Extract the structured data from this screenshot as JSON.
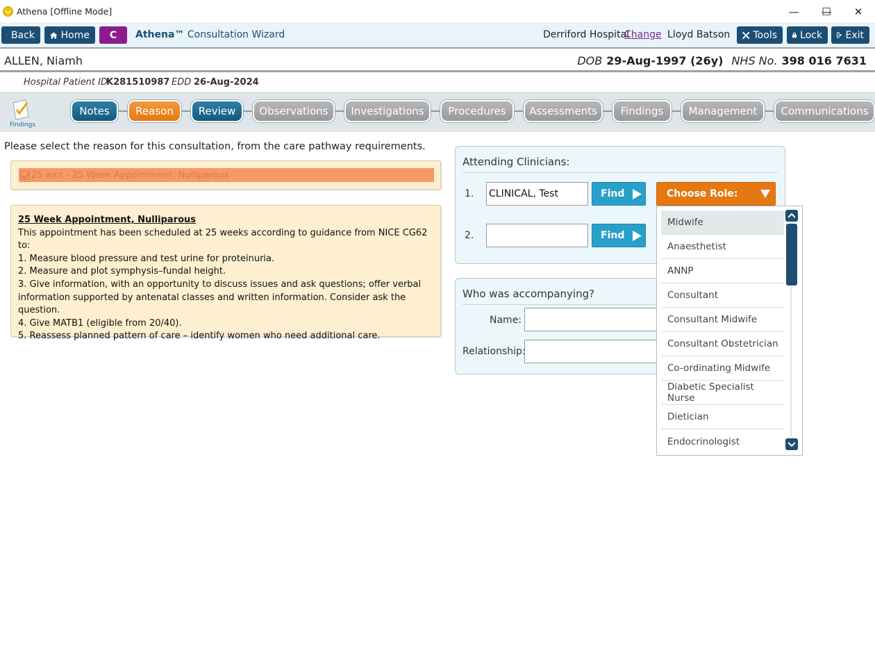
{
  "window": {
    "title": "Athena [Offline Mode]",
    "minimize": "—",
    "maximize": "☐",
    "close": "✕"
  },
  "toolbar": {
    "back": "Back",
    "home": "Home",
    "c_label": "C",
    "brand_name": "Athena™",
    "brand_sub": "Consultation Wizard",
    "hospital": "Derriford Hospital",
    "change": "Change",
    "user": "Lloyd Batson",
    "tools": "Tools",
    "lock": "Lock",
    "exit": "Exit"
  },
  "patient": {
    "name": "ALLEN, Niamh",
    "dob_label": "DOB",
    "dob": "29-Aug-1997 (26y)",
    "nhs_label": "NHS No.",
    "nhs": "398 016 7631",
    "hpid_label": "Hospital Patient ID",
    "hpid": "K281510987",
    "edd_label": "EDD",
    "edd": "26-Aug-2024"
  },
  "wizard": {
    "findings_label": "Findings",
    "steps": [
      "Notes",
      "Reason",
      "Review",
      "Observations",
      "Investigations",
      "Procedures",
      "Assessments",
      "Findings",
      "Management",
      "Communications"
    ]
  },
  "reason": {
    "instruction": "Please select the reason for this consultation, from the care pathway requirements.",
    "item": "25 wks - 25 Week Appointment, Nulliparous",
    "heading": "25 Week Appointment, Nulliparous",
    "lines": [
      "This appointment has been scheduled at 25 weeks according to guidance from NICE CG62 to:",
      "1. Measure blood pressure and test urine for proteinuria.",
      "2. Measure and plot symphysis–fundal height.",
      "3. Give information, with an opportunity to discuss issues and ask questions; offer verbal information supported by antenatal classes and written information. Consider ask the question.",
      "4. Give MATB1 (eligible from 20/40).",
      "5. Reassess planned pattern of care – identify women who need additional care."
    ]
  },
  "clinicians": {
    "title": "Attending Clinicians:",
    "row1_num": "1.",
    "row1_value": "CLINICAL, Test",
    "row2_num": "2.",
    "row2_value": "",
    "find": "Find",
    "choose_role": "Choose Role:"
  },
  "accompany": {
    "title": "Who was accompanying?",
    "name_label": "Name:",
    "relationship_label": "Relationship:"
  },
  "roles": [
    "Midwife",
    "Anaesthetist",
    "ANNP",
    "Consultant",
    "Consultant Midwife",
    "Consultant Obstetrician",
    "Co-ordinating Midwife",
    "Diabetic Specialist Nurse",
    "Dietician",
    "Endocrinologist"
  ]
}
